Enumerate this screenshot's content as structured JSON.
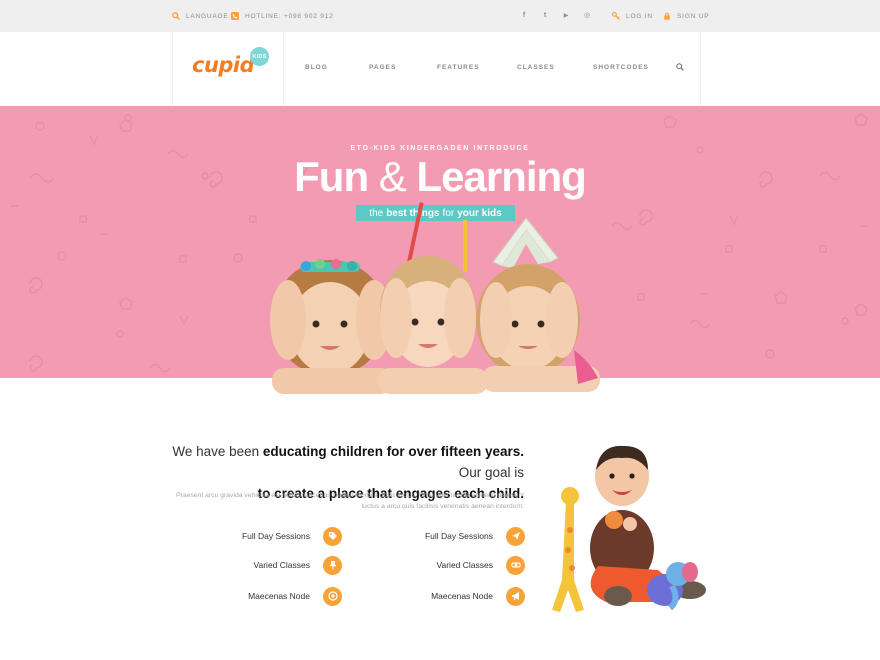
{
  "topbar": {
    "language": "LANGUAGE",
    "hotline": "HOTLINE: +098 902 912",
    "social": [
      {
        "icon": "facebook-icon",
        "glyph": "f"
      },
      {
        "icon": "twitter-icon",
        "glyph": "t"
      },
      {
        "icon": "youtube-icon",
        "glyph": "▶"
      },
      {
        "icon": "instagram-icon",
        "glyph": "◎"
      }
    ],
    "login": "LOG IN",
    "signup": "SIGN UP"
  },
  "header": {
    "logo": "cupid",
    "logo_badge": "KIDS",
    "nav": [
      "BLOG",
      "PAGES",
      "FEATURES",
      "CLASSES",
      "SHORTCODES"
    ]
  },
  "hero": {
    "kicker": "ETO-KIDS KINDERGADEN INTRODUCE",
    "title_part1": "Fun",
    "title_amp": "&",
    "title_part2": "Learning",
    "tag_part1": "the",
    "tag_part2": "best things",
    "tag_part3": "for",
    "tag_part4": "your kids"
  },
  "about": {
    "head_1": "We have been",
    "head_2": "educating children for over fifteen years.",
    "head_3": "Our goal is",
    "head_4": "to create a place that engages each child.",
    "text": "Praesent arcu gravida vehicula est node maecenas loareet morbi a dosis luctus. Urna eget lacinia eleifend praesent luctus a arcu quis facilisis venenatis aenean interdum.",
    "features_left": [
      {
        "label": "Full Day Sessions",
        "icon": "tag-icon"
      },
      {
        "label": "Varied Classes",
        "icon": "pin-icon"
      },
      {
        "label": "Maecenas Node",
        "icon": "target-icon"
      }
    ],
    "features_right": [
      {
        "label": "Full Day Sessions",
        "icon": "plane-icon"
      },
      {
        "label": "Varied Classes",
        "icon": "link-icon"
      },
      {
        "label": "Maecenas Node",
        "icon": "megaphone-icon"
      }
    ]
  },
  "colors": {
    "accent_orange": "#f8a336",
    "logo_orange": "#f57c1f",
    "hero_pink": "#f39bb3",
    "teal": "#5dc9c7"
  }
}
